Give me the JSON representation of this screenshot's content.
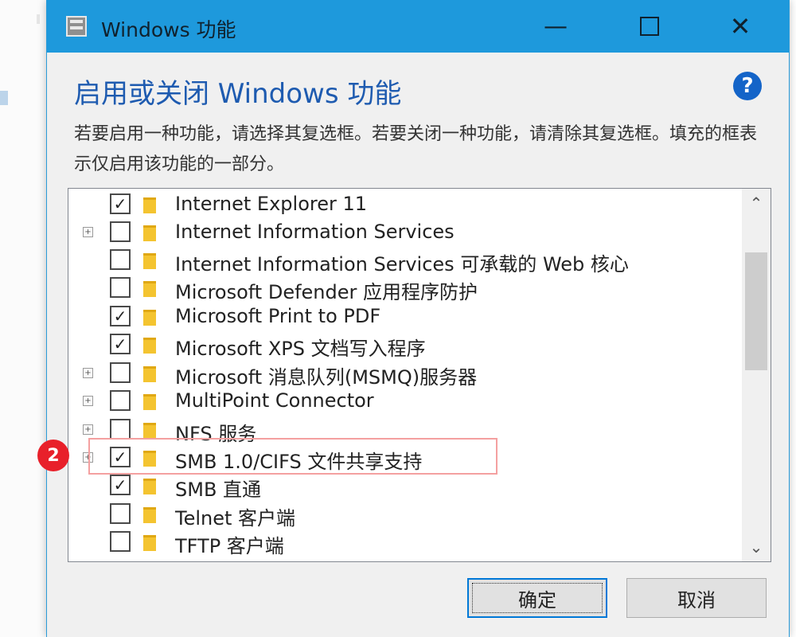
{
  "window": {
    "title": "Windows 功能",
    "minimize": "—",
    "close": "✕"
  },
  "heading": "启用或关闭 Windows 功能",
  "help": "?",
  "description": "若要启用一种功能，请选择其复选框。若要关闭一种功能，请清除其复选框。填充的框表示仅启用该功能的一部分。",
  "features": [
    {
      "label": "Internet Explorer 11",
      "checked": true,
      "expandable": false
    },
    {
      "label": "Internet Information Services",
      "checked": false,
      "expandable": true
    },
    {
      "label": "Internet Information Services 可承载的 Web 核心",
      "checked": false,
      "expandable": false
    },
    {
      "label": "Microsoft Defender 应用程序防护",
      "checked": false,
      "expandable": false
    },
    {
      "label": "Microsoft Print to PDF",
      "checked": true,
      "expandable": false
    },
    {
      "label": "Microsoft XPS 文档写入程序",
      "checked": true,
      "expandable": false
    },
    {
      "label": "Microsoft 消息队列(MSMQ)服务器",
      "checked": false,
      "expandable": true
    },
    {
      "label": "MultiPoint Connector",
      "checked": false,
      "expandable": true
    },
    {
      "label": "NFS 服务",
      "checked": false,
      "expandable": true
    },
    {
      "label": "SMB 1.0/CIFS 文件共享支持",
      "checked": true,
      "expandable": true
    },
    {
      "label": "SMB 直通",
      "checked": true,
      "expandable": false
    },
    {
      "label": "Telnet 客户端",
      "checked": false,
      "expandable": false
    },
    {
      "label": "TFTP 客户端",
      "checked": false,
      "expandable": false
    }
  ],
  "annotation": {
    "badge": "2"
  },
  "buttons": {
    "ok": "确定",
    "cancel": "取消"
  },
  "colors": {
    "titlebar": "#1e99dc",
    "heading": "#1e5bb0",
    "badge": "#e8202a"
  }
}
